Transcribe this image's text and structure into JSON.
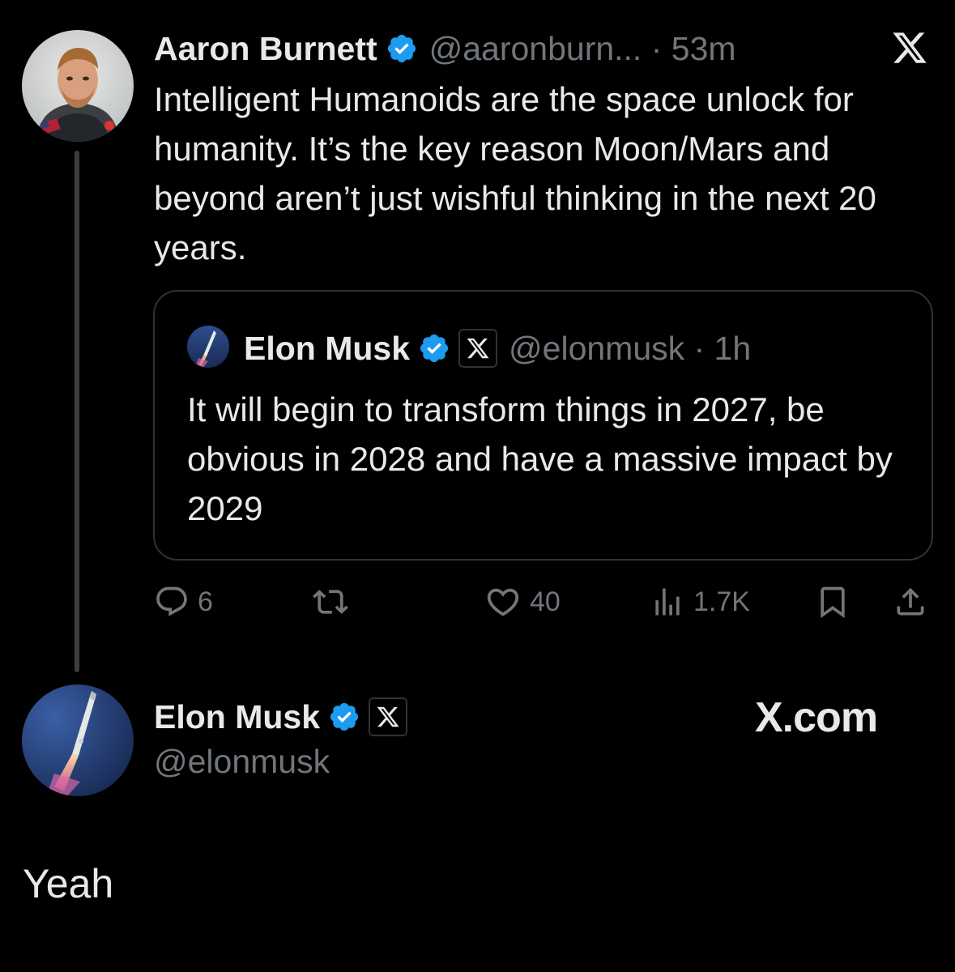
{
  "original_tweet": {
    "author_name": "Aaron Burnett",
    "handle_time": "@aaronburn... · 53m",
    "text": "Intelligent Humanoids are the space unlock for humanity. It’s the key reason Moon/Mars and beyond aren’t just wishful thinking in the next 20 years.",
    "avatar_icon": "astronaut-portrait",
    "verified_icon": "verified-badge-icon",
    "corner_icon": "x-logo-icon"
  },
  "quoted_tweet": {
    "author_name": "Elon Musk",
    "handle_time": "@elonmusk · 1h",
    "text": "It will begin to transform things in 2027, be obvious in 2028 and have a massive impact by 2029",
    "avatar_icon": "rocket-launch-avatar"
  },
  "actions": {
    "replies": "6",
    "reposts": "",
    "likes": "40",
    "views": "1.7K"
  },
  "reply": {
    "author_name": "Elon Musk",
    "handle": "@elonmusk",
    "brand": "X.com",
    "text": "Yeah"
  },
  "colors": {
    "background": "#000000",
    "primary_text": "#e7e9ea",
    "secondary_text": "#71767b",
    "verified_blue": "#1d9bf0",
    "border": "#2f3336"
  }
}
